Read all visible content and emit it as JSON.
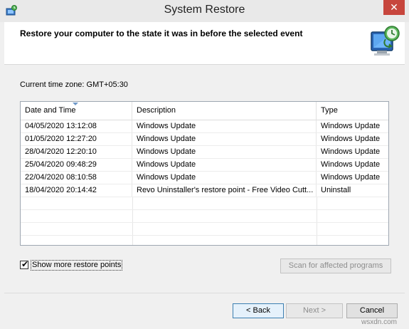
{
  "window": {
    "title": "System Restore",
    "close_glyph": "✕"
  },
  "header": {
    "text": "Restore your computer to the state it was in before the selected event",
    "icon": "system-restore-icon"
  },
  "time_zone_label": "Current time zone: GMT+05:30",
  "table": {
    "columns": [
      "Date and Time",
      "Description",
      "Type"
    ],
    "rows": [
      {
        "date": "04/05/2020 13:12:08",
        "description": "Windows Update",
        "type": "Windows Update"
      },
      {
        "date": "01/05/2020 12:27:20",
        "description": "Windows Update",
        "type": "Windows Update"
      },
      {
        "date": "28/04/2020 12:20:10",
        "description": "Windows Update",
        "type": "Windows Update"
      },
      {
        "date": "25/04/2020 09:48:29",
        "description": "Windows Update",
        "type": "Windows Update"
      },
      {
        "date": "22/04/2020 08:10:58",
        "description": "Windows Update",
        "type": "Windows Update"
      },
      {
        "date": "18/04/2020 20:14:42",
        "description": "Revo Uninstaller's restore point - Free Video Cutt...",
        "type": "Uninstall"
      }
    ]
  },
  "show_more": {
    "label": "Show more restore points",
    "checked": true,
    "checkmark": "✔"
  },
  "buttons": {
    "scan": "Scan for affected programs",
    "back": "< Back",
    "next": "Next >",
    "cancel": "Cancel"
  },
  "watermark": "wsxdn.com"
}
